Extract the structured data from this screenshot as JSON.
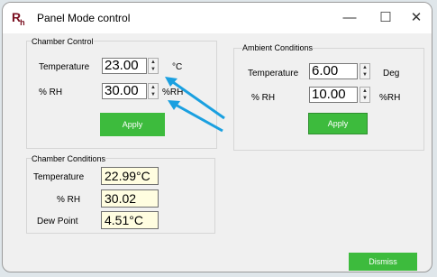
{
  "window": {
    "logo": "R",
    "logo_sub": "h",
    "title": "Panel Mode control",
    "minimize": "—",
    "maximize": "☐",
    "close": "✕"
  },
  "chamber_control": {
    "title": "Chamber Control",
    "temperature_label": "Temperature",
    "temperature_value": "23.00",
    "temperature_unit": "°C",
    "rh_label": "% RH",
    "rh_value": "30.00",
    "rh_unit": "%RH",
    "apply": "Apply"
  },
  "ambient_conditions": {
    "title": "Ambient Conditions",
    "temperature_label": "Temperature",
    "temperature_value": "6.00",
    "temperature_unit": "Deg",
    "rh_label": "% RH",
    "rh_value": "10.00",
    "rh_unit": "%RH",
    "apply": "Apply"
  },
  "chamber_conditions": {
    "title": "Chamber Conditions",
    "temperature_label": "Temperature",
    "temperature_value": "22.99°C",
    "rh_label": "% RH",
    "rh_value": "30.02",
    "dewpoint_label": "Dew Point",
    "dewpoint_value": "4.51°C"
  },
  "footer": {
    "dismiss": "Dismiss"
  },
  "colors": {
    "apply_green": "#3dbb3d",
    "readout_bg": "#fffde0",
    "arrow_blue": "#1aa0e0"
  }
}
